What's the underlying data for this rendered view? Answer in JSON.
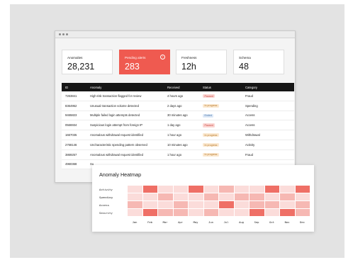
{
  "summary_cards": [
    {
      "label": "Anomalies",
      "value": "28,231",
      "highlight": false
    },
    {
      "label": "Pending alerts",
      "value": "283",
      "highlight": true
    },
    {
      "label": "Freshness",
      "value": "12h",
      "highlight": false
    },
    {
      "label": "Schema",
      "value": "48",
      "highlight": false
    }
  ],
  "table": {
    "columns": [
      "ID",
      "Anomaly",
      "Received",
      "Status",
      "Category"
    ],
    "rows": [
      {
        "id": "7263841",
        "anomaly": "High-risk transaction flagged for review",
        "received": "4 hours ago",
        "status": "Paused",
        "status_type": "paused",
        "category": "Fraud"
      },
      {
        "id": "8364952",
        "anomaly": "Unusual transaction volume detected",
        "received": "2 days ago",
        "status": "In progress",
        "status_type": "inprog",
        "category": "Spending"
      },
      {
        "id": "9465823",
        "anomaly": "Multiple failed login attempts detected",
        "received": "30 minutes ago",
        "status": "Ended",
        "status_type": "ended",
        "category": "Access"
      },
      {
        "id": "0566934",
        "anomaly": "Suspicious login attempt from foreign IP",
        "received": "1 day ago",
        "status": "Paused",
        "status_type": "paused",
        "category": "Access"
      },
      {
        "id": "1667035",
        "anomaly": "Anomalous withdrawal request identified",
        "received": "1 hour ago",
        "status": "In progress",
        "status_type": "inprog",
        "category": "Withdrawal"
      },
      {
        "id": "2768146",
        "anomaly": "Uncharacteristic spending pattern observed",
        "received": "10 minutes ago",
        "status": "In progress",
        "status_type": "inprog",
        "category": "Activity"
      },
      {
        "id": "3869257",
        "anomaly": "Anomalous withdrawal request identified",
        "received": "1 hour ago",
        "status": "In progress",
        "status_type": "inprog",
        "category": "Fraud"
      },
      {
        "id": "4960368",
        "anomaly": "Su",
        "received": "",
        "status": "",
        "status_type": "",
        "category": ""
      }
    ]
  },
  "heatmap": {
    "title": "Anomaly Heatmap",
    "rows": [
      "Activity",
      "Spending",
      "Access",
      "Security"
    ],
    "months": [
      "Jan",
      "Feb",
      "Mar",
      "Apr",
      "May",
      "Jun",
      "Jul",
      "Aug",
      "Sep",
      "Oct",
      "Nov",
      "Dec"
    ],
    "levels": [
      [
        1,
        3,
        1,
        1,
        3,
        1,
        2,
        1,
        1,
        3,
        1,
        3
      ],
      [
        1,
        1,
        2,
        1,
        1,
        2,
        1,
        2,
        2,
        1,
        2,
        1
      ],
      [
        2,
        1,
        1,
        2,
        1,
        1,
        3,
        1,
        2,
        2,
        1,
        2
      ],
      [
        1,
        3,
        2,
        2,
        1,
        2,
        1,
        1,
        3,
        1,
        3,
        2
      ]
    ],
    "colors": {
      "1": "#fbdcda",
      "2": "#f6b8b3",
      "3": "#ef6f66"
    }
  },
  "icons": {
    "alert_card": "info-icon"
  }
}
